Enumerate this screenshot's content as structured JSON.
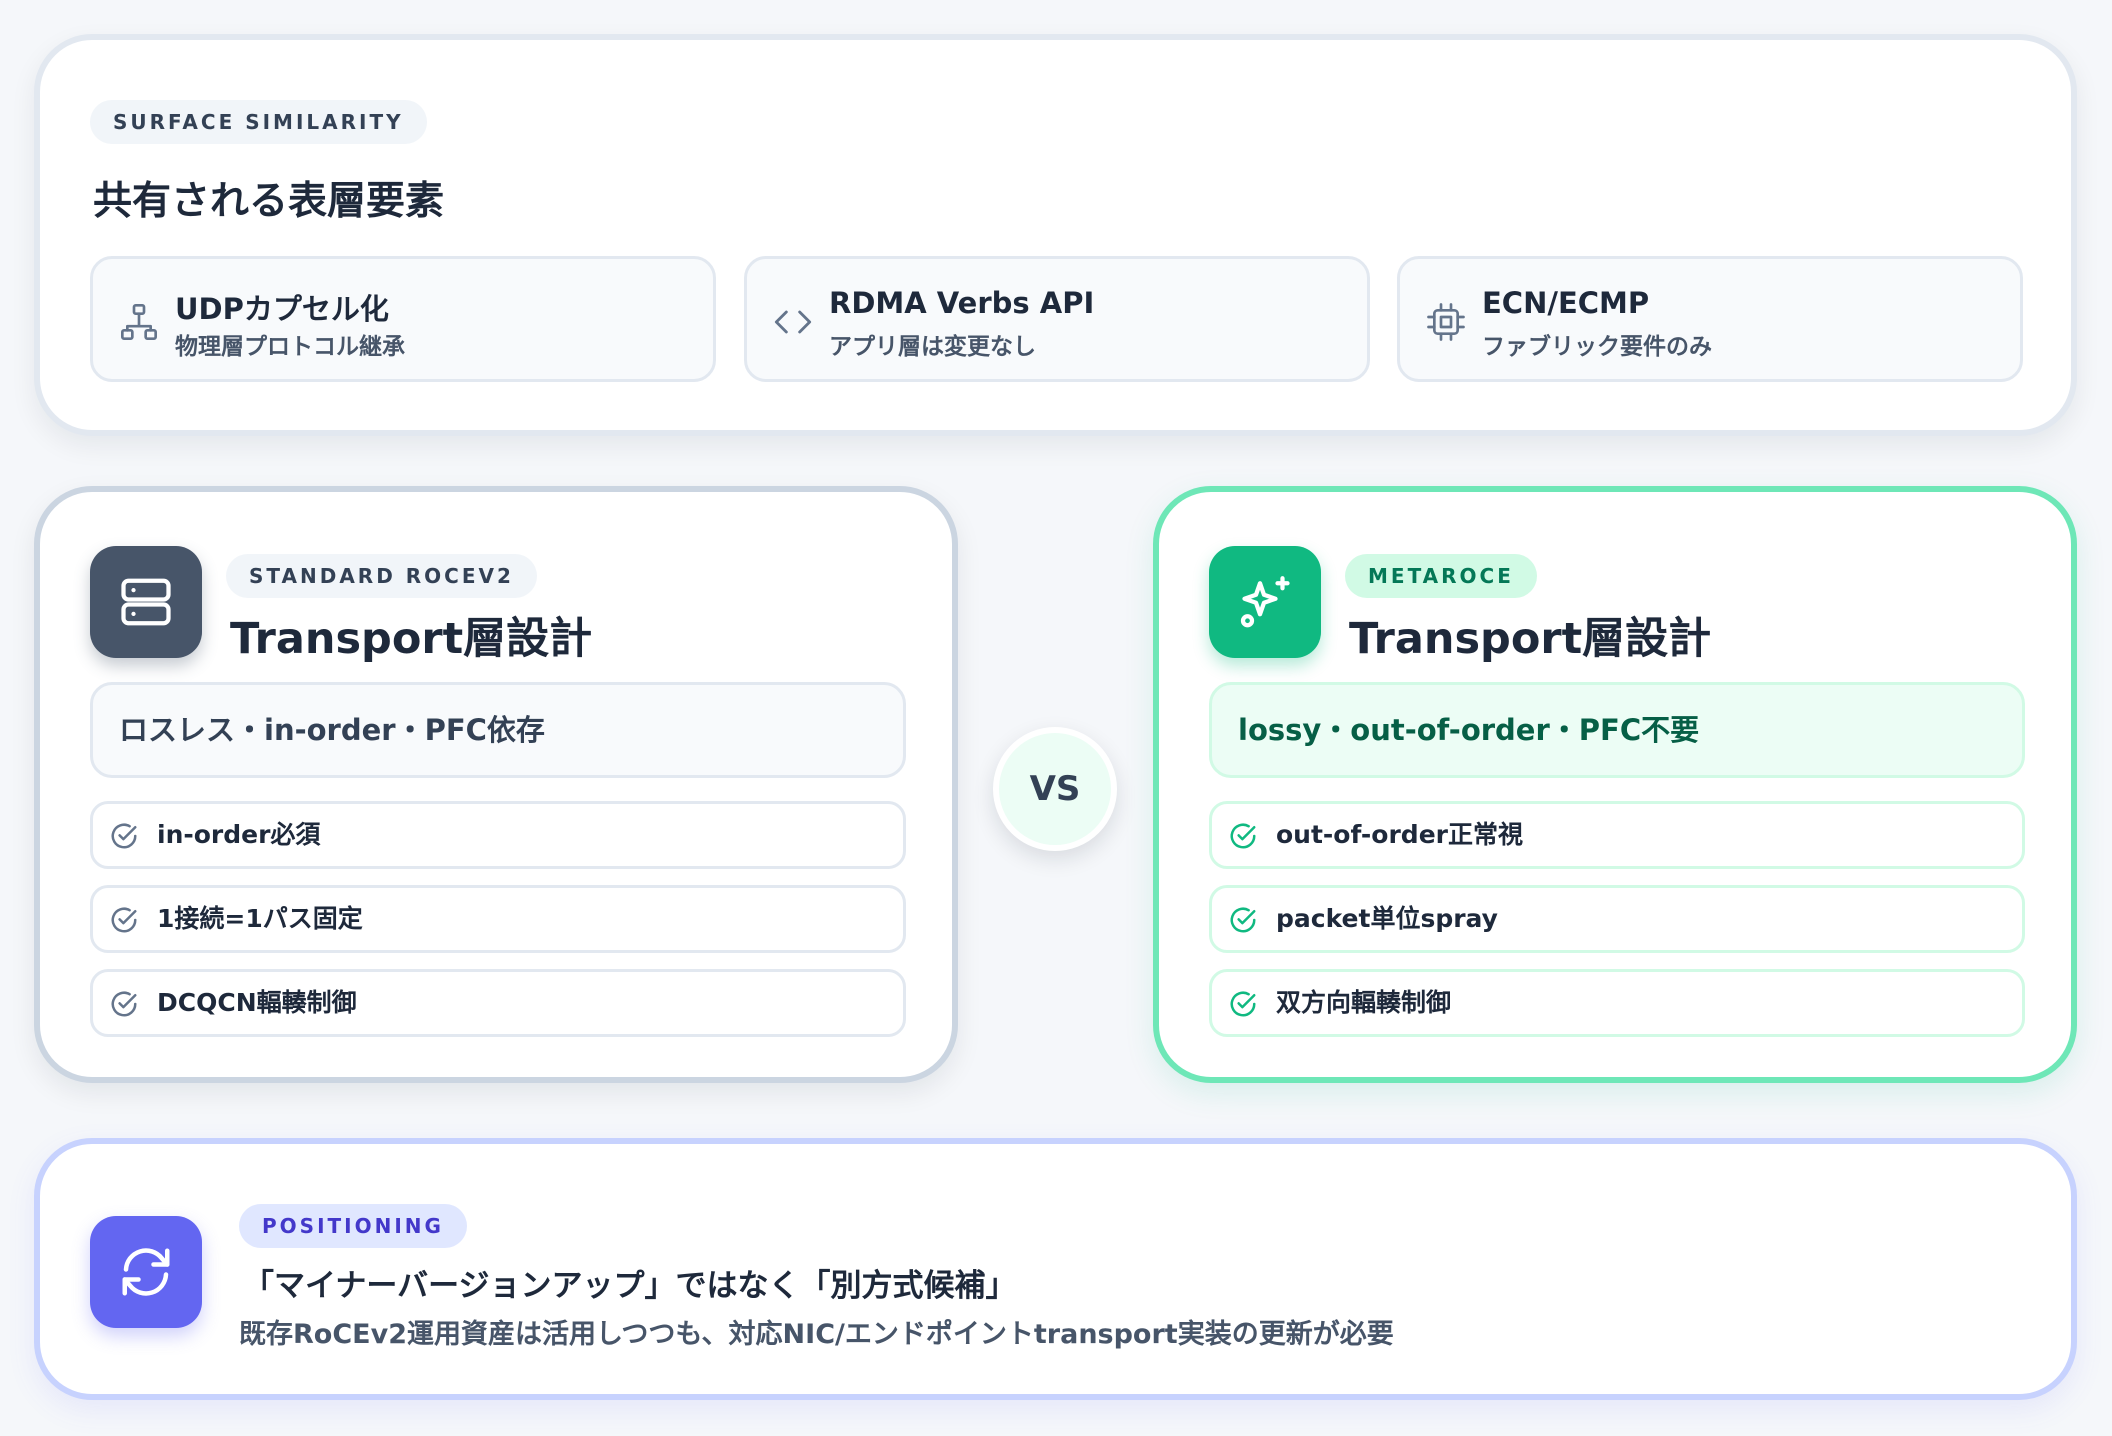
{
  "top": {
    "tag": "SURFACE SIMILARITY",
    "title": "共有される表層要素",
    "features": [
      {
        "icon": "network-icon",
        "title": "UDPカプセル化",
        "subtitle": "物理層プロトコル継承"
      },
      {
        "icon": "code-icon",
        "title": "RDMA Verbs API",
        "subtitle": "アプリ層は変更なし"
      },
      {
        "icon": "chip-icon",
        "title": "ECN/ECMP",
        "subtitle": "ファブリック要件のみ"
      }
    ]
  },
  "standard": {
    "icon": "server-icon",
    "tag": "STANDARD ROCEV2",
    "title": "Transport層設計",
    "summary": "ロスレス・in-order・PFC依存",
    "items": [
      "in-order必須",
      "1接続=1パス固定",
      "DCQCN輻輳制御"
    ]
  },
  "vs_label": "VS",
  "metaroce": {
    "icon": "sparkles-icon",
    "tag": "METAROCE",
    "title": "Transport層設計",
    "summary": "lossy・out-of-order・PFC不要",
    "items": [
      "out-of-order正常視",
      "packet単位spray",
      "双方向輻輳制御"
    ]
  },
  "positioning": {
    "icon": "refresh-icon",
    "tag": "POSITIONING",
    "title": "「マイナーバージョンアップ」ではなく「別方式候補」",
    "description": "既存RoCEv2運用資産は活用しつつも、対応NIC/エンドポイントtransport実装の更新が必要"
  },
  "colors": {
    "slate": "#475569",
    "emerald": "#10b981",
    "indigo": "#6366f1"
  }
}
